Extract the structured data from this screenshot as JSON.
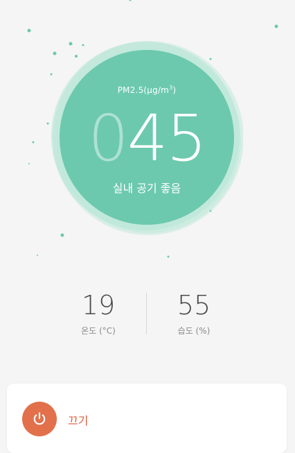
{
  "air_quality": {
    "unit_label": "PM2.5(μg/m",
    "unit_superscript": "3",
    "unit_close": ")",
    "value_lead": "0",
    "value_main": "45",
    "status": "실내 공기 좋음"
  },
  "stats": {
    "temperature": {
      "value": "19",
      "label": "온도 (°C)"
    },
    "humidity": {
      "value": "55",
      "label": "습도 (%)"
    }
  },
  "power": {
    "label": "끄기",
    "icon": "power-icon"
  },
  "colors": {
    "gauge_fill": "#6cc9ad",
    "gauge_halo": "#a9e2cf",
    "power_button": "#e2704b",
    "power_text": "#e25a3a",
    "background": "#f5f5f5"
  }
}
